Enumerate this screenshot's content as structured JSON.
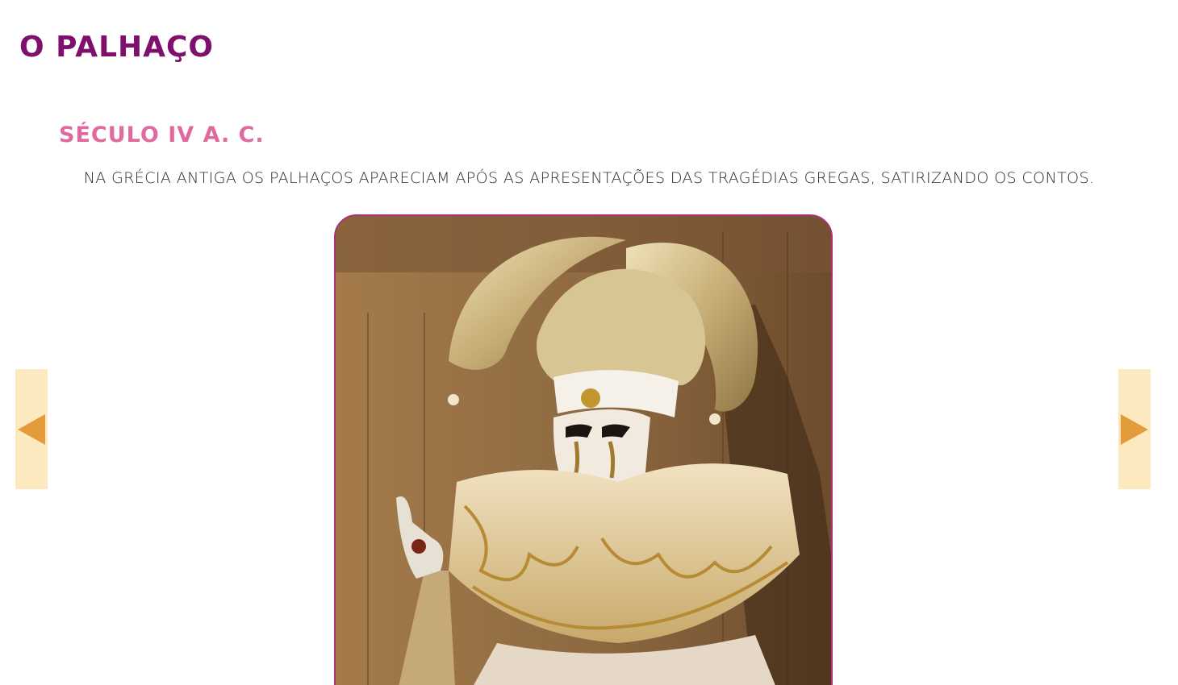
{
  "page": {
    "title": "O PALHAÇO",
    "section_heading": "SÉCULO IV A. C.",
    "caption": "NA GRÉCIA ANTIGA OS PALHAÇOS APARECIAM APÓS AS APRESENTAÇÕES DAS TRAGÉDIAS GREGAS, SATIRIZANDO OS CONTOS."
  },
  "navigation": {
    "prev_icon": "triangle-left-icon",
    "next_icon": "triangle-right-icon"
  },
  "colors": {
    "title": "#7e0f6d",
    "heading": "#e0699f",
    "frame_border": "#a8337d",
    "nav_background": "#fde9c0",
    "nav_arrow": "#e49b3c"
  }
}
